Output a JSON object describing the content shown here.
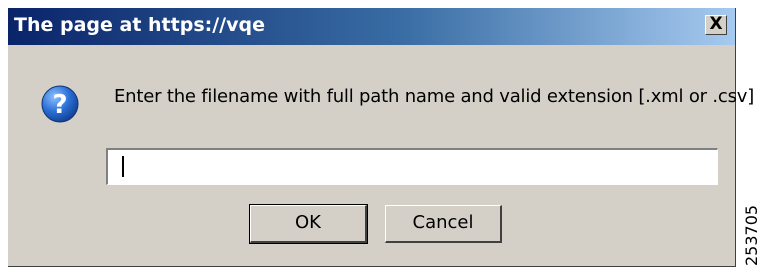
{
  "dialog": {
    "title": "The page at https://vqe",
    "close_glyph": "X",
    "icon": "question-icon",
    "prompt": "Enter the filename with full path name and valid extension [.xml or .csv]",
    "input_value": "",
    "ok_label": "OK",
    "cancel_label": "Cancel"
  },
  "figure_number": "253705",
  "colors": {
    "title_gradient_start": "#0a246a",
    "title_gradient_end": "#a6caf0",
    "dialog_face": "#d4d0c8",
    "icon_blue": "#1f5fc4"
  }
}
